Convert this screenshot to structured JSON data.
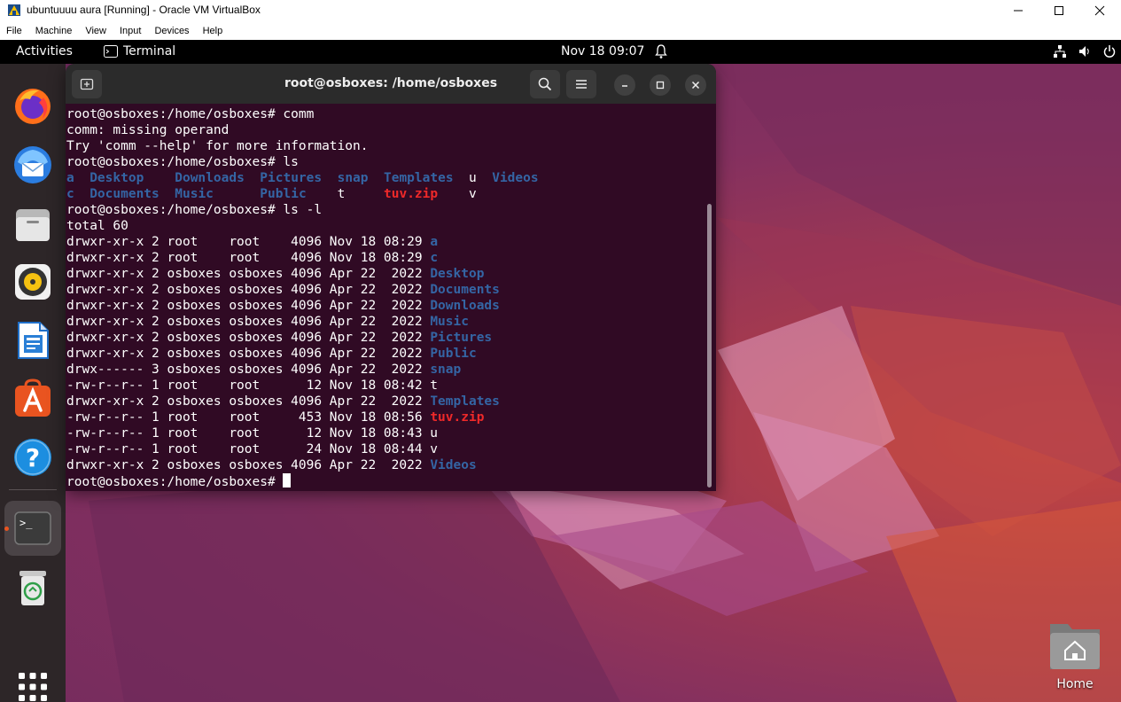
{
  "vbox": {
    "title": "ubuntuuuu aura [Running] - Oracle VM VirtualBox",
    "menu": [
      "File",
      "Machine",
      "View",
      "Input",
      "Devices",
      "Help"
    ]
  },
  "topbar": {
    "activities": "Activities",
    "app_name": "Terminal",
    "clock": "Nov 18  09:07"
  },
  "dock": {
    "items": [
      "firefox-icon",
      "thunderbird-icon",
      "files-icon",
      "rhythmbox-icon",
      "libreoffice-writer-icon",
      "app-center-icon",
      "help-icon",
      "terminal-icon",
      "trash-icon"
    ]
  },
  "terminal": {
    "title": "root@osboxes: /home/osboxes",
    "lines": [
      [
        {
          "t": "root@osboxes:/home/osboxes# comm"
        }
      ],
      [
        {
          "t": "comm: missing operand"
        }
      ],
      [
        {
          "t": "Try 'comm --help' for more information."
        }
      ],
      [
        {
          "t": "root@osboxes:/home/osboxes# ls"
        }
      ],
      [
        {
          "t": "a",
          "c": "blue"
        },
        {
          "t": "  "
        },
        {
          "t": "Desktop",
          "c": "blue"
        },
        {
          "t": "    "
        },
        {
          "t": "Downloads",
          "c": "blue"
        },
        {
          "t": "  "
        },
        {
          "t": "Pictures",
          "c": "blue"
        },
        {
          "t": "  "
        },
        {
          "t": "snap",
          "c": "blue"
        },
        {
          "t": "  "
        },
        {
          "t": "Templates",
          "c": "blue"
        },
        {
          "t": "  u  "
        },
        {
          "t": "Videos",
          "c": "blue"
        }
      ],
      [
        {
          "t": "c",
          "c": "blue"
        },
        {
          "t": "  "
        },
        {
          "t": "Documents",
          "c": "blue"
        },
        {
          "t": "  "
        },
        {
          "t": "Music",
          "c": "blue"
        },
        {
          "t": "      "
        },
        {
          "t": "Public",
          "c": "blue"
        },
        {
          "t": "    t     "
        },
        {
          "t": "tuv.zip",
          "c": "red"
        },
        {
          "t": "    v"
        }
      ],
      [
        {
          "t": "root@osboxes:/home/osboxes# ls -l"
        }
      ],
      [
        {
          "t": "total 60"
        }
      ],
      [
        {
          "t": "drwxr-xr-x 2 root    root    4096 Nov 18 08:29 "
        },
        {
          "t": "a",
          "c": "blue"
        }
      ],
      [
        {
          "t": "drwxr-xr-x 2 root    root    4096 Nov 18 08:29 "
        },
        {
          "t": "c",
          "c": "blue"
        }
      ],
      [
        {
          "t": "drwxr-xr-x 2 osboxes osboxes 4096 Apr 22  2022 "
        },
        {
          "t": "Desktop",
          "c": "blue"
        }
      ],
      [
        {
          "t": "drwxr-xr-x 2 osboxes osboxes 4096 Apr 22  2022 "
        },
        {
          "t": "Documents",
          "c": "blue"
        }
      ],
      [
        {
          "t": "drwxr-xr-x 2 osboxes osboxes 4096 Apr 22  2022 "
        },
        {
          "t": "Downloads",
          "c": "blue"
        }
      ],
      [
        {
          "t": "drwxr-xr-x 2 osboxes osboxes 4096 Apr 22  2022 "
        },
        {
          "t": "Music",
          "c": "blue"
        }
      ],
      [
        {
          "t": "drwxr-xr-x 2 osboxes osboxes 4096 Apr 22  2022 "
        },
        {
          "t": "Pictures",
          "c": "blue"
        }
      ],
      [
        {
          "t": "drwxr-xr-x 2 osboxes osboxes 4096 Apr 22  2022 "
        },
        {
          "t": "Public",
          "c": "blue"
        }
      ],
      [
        {
          "t": "drwx------ 3 osboxes osboxes 4096 Apr 22  2022 "
        },
        {
          "t": "snap",
          "c": "blue"
        }
      ],
      [
        {
          "t": "-rw-r--r-- 1 root    root      12 Nov 18 08:42 t"
        }
      ],
      [
        {
          "t": "drwxr-xr-x 2 osboxes osboxes 4096 Apr 22  2022 "
        },
        {
          "t": "Templates",
          "c": "blue"
        }
      ],
      [
        {
          "t": "-rw-r--r-- 1 root    root     453 Nov 18 08:56 "
        },
        {
          "t": "tuv.zip",
          "c": "red"
        }
      ],
      [
        {
          "t": "-rw-r--r-- 1 root    root      12 Nov 18 08:43 u"
        }
      ],
      [
        {
          "t": "-rw-r--r-- 1 root    root      24 Nov 18 08:44 v"
        }
      ],
      [
        {
          "t": "drwxr-xr-x 2 osboxes osboxes 4096 Apr 22  2022 "
        },
        {
          "t": "Videos",
          "c": "blue"
        }
      ],
      [
        {
          "t": "root@osboxes:/home/osboxes# "
        },
        {
          "cursor": true
        }
      ]
    ]
  },
  "desktop": {
    "home_label": "Home"
  },
  "colors": {
    "terminal_bg": "#300a24",
    "dir_blue": "#3465a4",
    "archive_red": "#ef2929",
    "accent": "#e95420"
  }
}
